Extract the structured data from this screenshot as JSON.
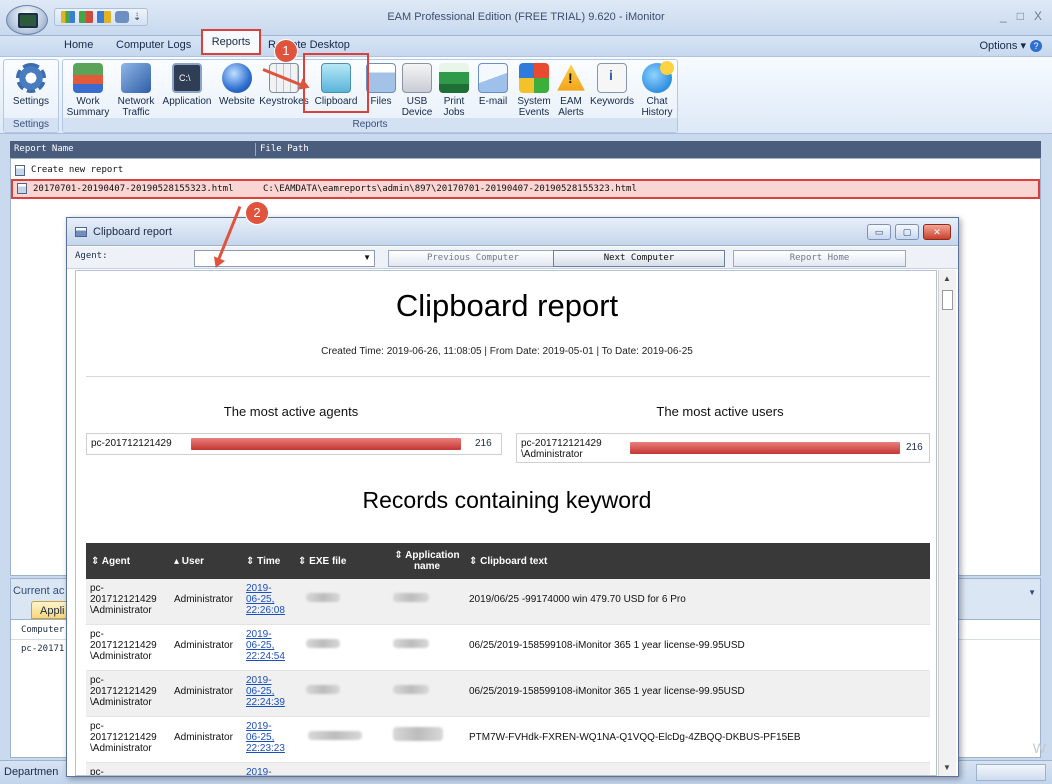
{
  "window": {
    "title": "EAM Professional Edition (FREE TRIAL) 9.620 - iMonitor",
    "controls": [
      "_",
      "□",
      "X"
    ]
  },
  "quick_access": {
    "dropdown": "⇣"
  },
  "menu": {
    "tabs": [
      "Home",
      "Computer Logs",
      "Reports",
      "Remote Desktop"
    ],
    "options": "Options",
    "help": "?"
  },
  "ribbon": {
    "settings_group": {
      "button": "Settings",
      "label": "Settings"
    },
    "reports_group": {
      "label": "Reports",
      "buttons": [
        {
          "label": "Work Summary",
          "icon": "work-summary-icon"
        },
        {
          "label": "Network Traffic",
          "icon": "network-traffic-icon"
        },
        {
          "label": "Application",
          "icon": "application-icon"
        },
        {
          "label": "Website",
          "icon": "website-globe-icon"
        },
        {
          "label": "Keystrokes",
          "icon": "keyboard-icon"
        },
        {
          "label": "Clipboard",
          "icon": "clipboard-icon"
        },
        {
          "label": "Files",
          "icon": "files-icon"
        },
        {
          "label": "USB Device",
          "icon": "usb-icon"
        },
        {
          "label": "Print Jobs",
          "icon": "printer-icon"
        },
        {
          "label": "E-mail",
          "icon": "email-icon"
        },
        {
          "label": "System Events",
          "icon": "system-events-icon"
        },
        {
          "label": "EAM Alerts",
          "icon": "alert-icon"
        },
        {
          "label": "Keywords",
          "icon": "keywords-icon"
        },
        {
          "label": "Chat History",
          "icon": "chat-icon"
        }
      ]
    }
  },
  "report_list": {
    "columns": [
      "Report Name",
      "File Path"
    ],
    "rows": [
      {
        "name": "Create new report",
        "path": ""
      },
      {
        "name": "20170701-20190407-20190528155323.html",
        "path": "C:\\EAMDATA\\eamreports\\admin\\897\\20170701-20190407-20190528155323.html"
      }
    ]
  },
  "bottom_panel": {
    "title": "Current ac",
    "tab": "Appli",
    "column": "Computer",
    "value": "pc-20171",
    "dropdown": "▼"
  },
  "status": {
    "label": "Departmen"
  },
  "watermark": "W",
  "annotations": {
    "badge1": "1",
    "badge2": "2"
  },
  "modal": {
    "title": "Clipboard report",
    "controls": [
      "▭",
      "▢",
      "✕"
    ],
    "toolbar": {
      "agent_label": "Agent:",
      "agent_value": "",
      "prev": "Previous Computer",
      "next": "Next Computer",
      "home": "Report Home"
    },
    "report": {
      "title": "Clipboard report",
      "meta": "Created Time: 2019-06-26, 11:08:05 | From Date: 2019-05-01 | To Date: 2019-06-25",
      "agents_title": "The most active agents",
      "users_title": "The most active users",
      "agents": [
        {
          "name": "pc-201712121429",
          "count": "216"
        }
      ],
      "users": [
        {
          "name": "pc-201712121429 \\Administrator",
          "count": "216"
        }
      ],
      "keyword_title": "Records containing keyword",
      "columns": [
        "⇕ Agent",
        "▴ User",
        "⇕ Time",
        "⇕ EXE file",
        "⇕ Application name",
        "⇕ Clipboard text"
      ],
      "rows": [
        {
          "agent": "pc-\n201712121429\n\\Administrator",
          "user": "Administrator",
          "time": "2019-\n06-25,\n22:26:08",
          "text": "2019/06/25 -99174000 win 479.70 USD for 6 Pro"
        },
        {
          "agent": "pc-\n201712121429\n\\Administrator",
          "user": "Administrator",
          "time": "2019-\n06-25,\n22:24:54",
          "text": "06/25/2019-158599108-iMonitor 365 1 year license-99.95USD"
        },
        {
          "agent": "pc-\n201712121429\n\\Administrator",
          "user": "Administrator",
          "time": "2019-\n06-25,\n22:24:39",
          "text": "06/25/2019-158599108-iMonitor 365 1 year license-99.95USD"
        },
        {
          "agent": "pc-\n201712121429\n\\Administrator",
          "user": "Administrator",
          "time": "2019-\n06-25,\n22:23:23",
          "text": "PTM7W-FVHdk-FXREN-WQ1NA-Q1VQQ-ElcDg-4ZBQQ-DKBUS-PF15EB"
        },
        {
          "agent": "pc-",
          "user": "",
          "time": "2019-",
          "text": ""
        }
      ]
    }
  }
}
